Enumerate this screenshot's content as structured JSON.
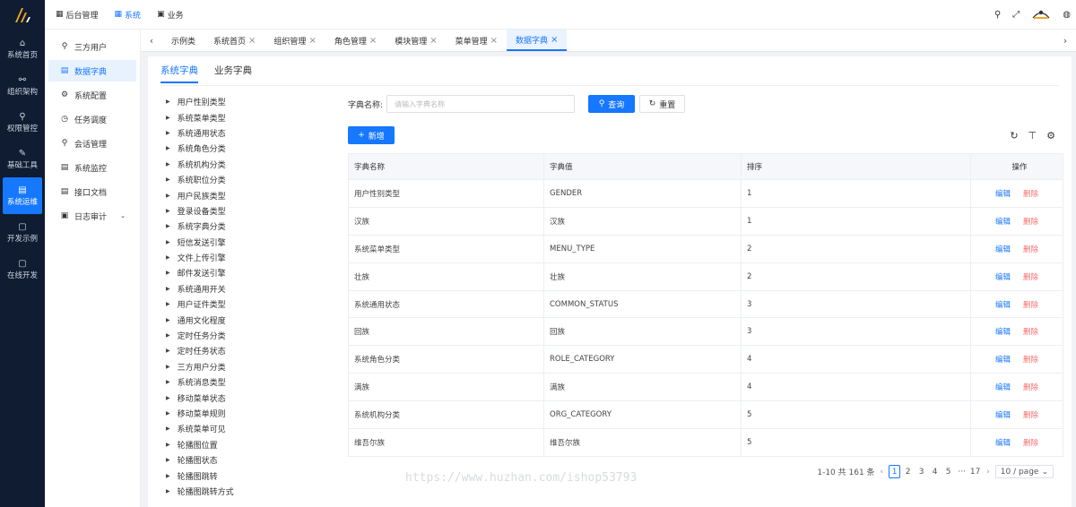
{
  "rail": {
    "logo": "/h",
    "items": [
      {
        "icon": "⌂",
        "label": "系统首页"
      },
      {
        "icon": "⚯",
        "label": "组织架构"
      },
      {
        "icon": "⚲",
        "label": "权限管控"
      },
      {
        "icon": "✎",
        "label": "基础工具"
      },
      {
        "icon": "▤",
        "label": "系统运维",
        "active": true
      },
      {
        "icon": "▢",
        "label": "开发示例"
      },
      {
        "icon": "▢",
        "label": "在线开发"
      }
    ]
  },
  "topbar": {
    "tabs": [
      {
        "icon": "▦",
        "label": "后台管理"
      },
      {
        "icon": "▦",
        "label": "系统",
        "active": true
      },
      {
        "icon": "▣",
        "label": "业务"
      }
    ],
    "icons": [
      "search-icon",
      "fullscreen-icon",
      "avatar",
      "language-icon"
    ]
  },
  "menu": {
    "items": [
      {
        "icon": "⚲",
        "label": "三方用户"
      },
      {
        "icon": "▤",
        "label": "数据字典",
        "active": true
      },
      {
        "icon": "⚙",
        "label": "系统配置"
      },
      {
        "icon": "◷",
        "label": "任务调度"
      },
      {
        "icon": "⚲",
        "label": "会话管理"
      },
      {
        "icon": "▤",
        "label": "系统监控"
      },
      {
        "icon": "▤",
        "label": "接口文档"
      },
      {
        "icon": "▣",
        "label": "日志审计",
        "caret": true
      }
    ]
  },
  "pagetabs": [
    {
      "label": "示例类",
      "closable": false
    },
    {
      "label": "系统首页",
      "closable": true
    },
    {
      "label": "组织管理",
      "closable": true
    },
    {
      "label": "角色管理",
      "closable": true
    },
    {
      "label": "模块管理",
      "closable": true
    },
    {
      "label": "菜单管理",
      "closable": true
    },
    {
      "label": "数据字典",
      "closable": true,
      "active": true
    }
  ],
  "subtabs": [
    {
      "label": "系统字典",
      "active": true
    },
    {
      "label": "业务字典"
    }
  ],
  "tree": [
    "用户性别类型",
    "系统菜单类型",
    "系统通用状态",
    "系统角色分类",
    "系统机构分类",
    "系统职位分类",
    "用户民族类型",
    "登录设备类型",
    "系统字典分类",
    "短信发送引擎",
    "文件上传引擎",
    "邮件发送引擎",
    "系统通用开关",
    "用户证件类型",
    "通用文化程度",
    "定时任务分类",
    "定时任务状态",
    "三方用户分类",
    "系统消息类型",
    "移动菜单状态",
    "移动菜单规则",
    "系统菜单可见",
    "轮播图位置",
    "轮播图状态",
    "轮播图跳转",
    "轮播图跳转方式"
  ],
  "search": {
    "label": "字典名称:",
    "placeholder": "请输入字典名称",
    "query_label": "查询",
    "reset_label": "重置"
  },
  "actions": {
    "add_label": "新增"
  },
  "table": {
    "headers": {
      "name": "字典名称",
      "value": "字典值",
      "sort": "排序",
      "op": "操作"
    },
    "rows": [
      {
        "name": "用户性别类型",
        "value": "GENDER",
        "sort": "1"
      },
      {
        "name": "汉族",
        "value": "汉族",
        "sort": "1"
      },
      {
        "name": "系统菜单类型",
        "value": "MENU_TYPE",
        "sort": "2"
      },
      {
        "name": "壮族",
        "value": "壮族",
        "sort": "2"
      },
      {
        "name": "系统通用状态",
        "value": "COMMON_STATUS",
        "sort": "3"
      },
      {
        "name": "回族",
        "value": "回族",
        "sort": "3"
      },
      {
        "name": "系统角色分类",
        "value": "ROLE_CATEGORY",
        "sort": "4"
      },
      {
        "name": "满族",
        "value": "满族",
        "sort": "4"
      },
      {
        "name": "系统机构分类",
        "value": "ORG_CATEGORY",
        "sort": "5"
      },
      {
        "name": "维吾尔族",
        "value": "维吾尔族",
        "sort": "5"
      }
    ],
    "edit_label": "编辑",
    "delete_label": "删除"
  },
  "pagination": {
    "total_text": "1-10 共 161 条",
    "pages": [
      "1",
      "2",
      "3",
      "4",
      "5",
      "···",
      "17"
    ],
    "current": "1",
    "page_size": "10 / page"
  },
  "watermark": "https://www.huzhan.com/ishop53793",
  "colors": {
    "primary": "#1677ff",
    "danger": "#f56c6c",
    "rail_bg": "#0f1c31"
  }
}
